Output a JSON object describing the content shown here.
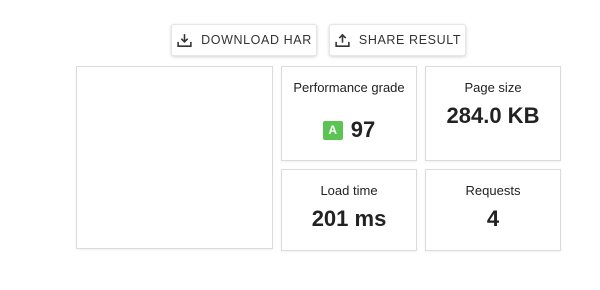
{
  "actions": {
    "download_label": "DOWNLOAD HAR",
    "share_label": "SHARE RESULT"
  },
  "metrics": {
    "performance": {
      "label": "Performance grade",
      "grade": "A",
      "score": "97",
      "grade_color": "#5cc453"
    },
    "page_size": {
      "label": "Page size",
      "value": "284.0 KB"
    },
    "load_time": {
      "label": "Load time",
      "value": "201 ms"
    },
    "requests": {
      "label": "Requests",
      "value": "4"
    }
  },
  "icons": {
    "download": "download-tray-icon",
    "share": "upload-share-icon"
  }
}
